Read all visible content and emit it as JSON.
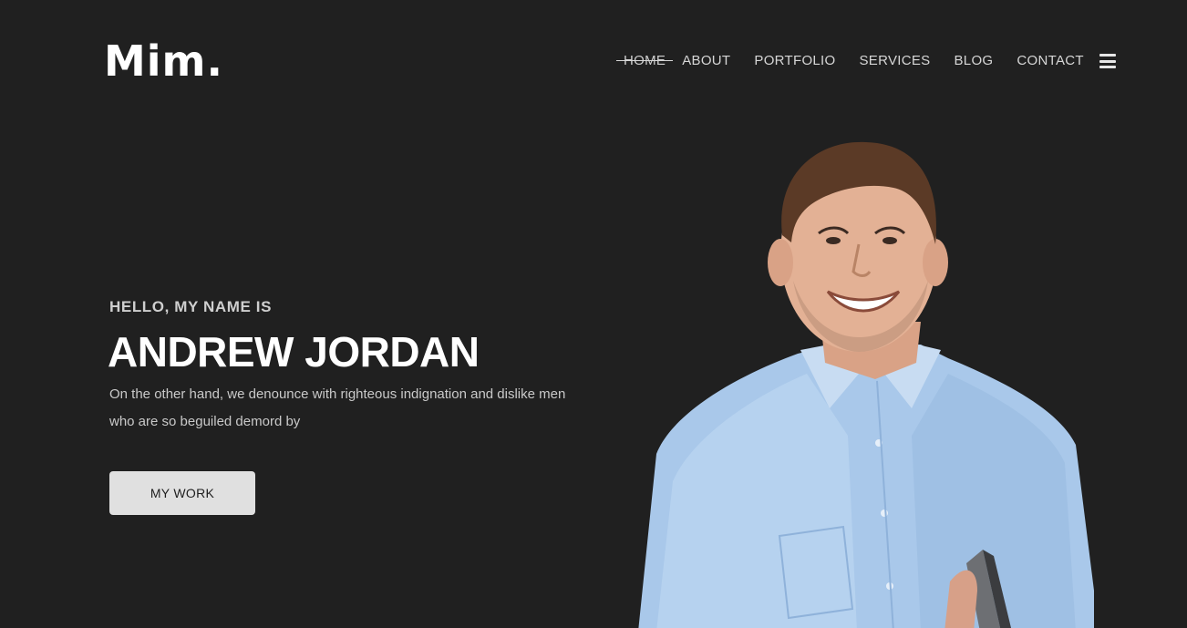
{
  "brand": {
    "logo_text": "Mim."
  },
  "nav": {
    "items": [
      {
        "label": "HOME",
        "active": true
      },
      {
        "label": "ABOUT",
        "active": false
      },
      {
        "label": "PORTFOLIO",
        "active": false
      },
      {
        "label": "SERVICES",
        "active": false
      },
      {
        "label": "BLOG",
        "active": false
      },
      {
        "label": "CONTACT",
        "active": false
      }
    ],
    "menu_icon": "hamburger-icon"
  },
  "hero": {
    "kicker": "HELLO, MY NAME IS",
    "name": "ANDREW JORDAN",
    "description": "On the other hand, we denounce with righteous indignation and dislike men who are so beguiled demord by",
    "cta_label": "MY WORK",
    "image": "smiling-man-portrait"
  },
  "colors": {
    "background": "#202020",
    "text_primary": "#ffffff",
    "text_secondary": "#c9c9c9",
    "button_bg": "#e0e0e0",
    "shirt": "#a9c8ea"
  }
}
